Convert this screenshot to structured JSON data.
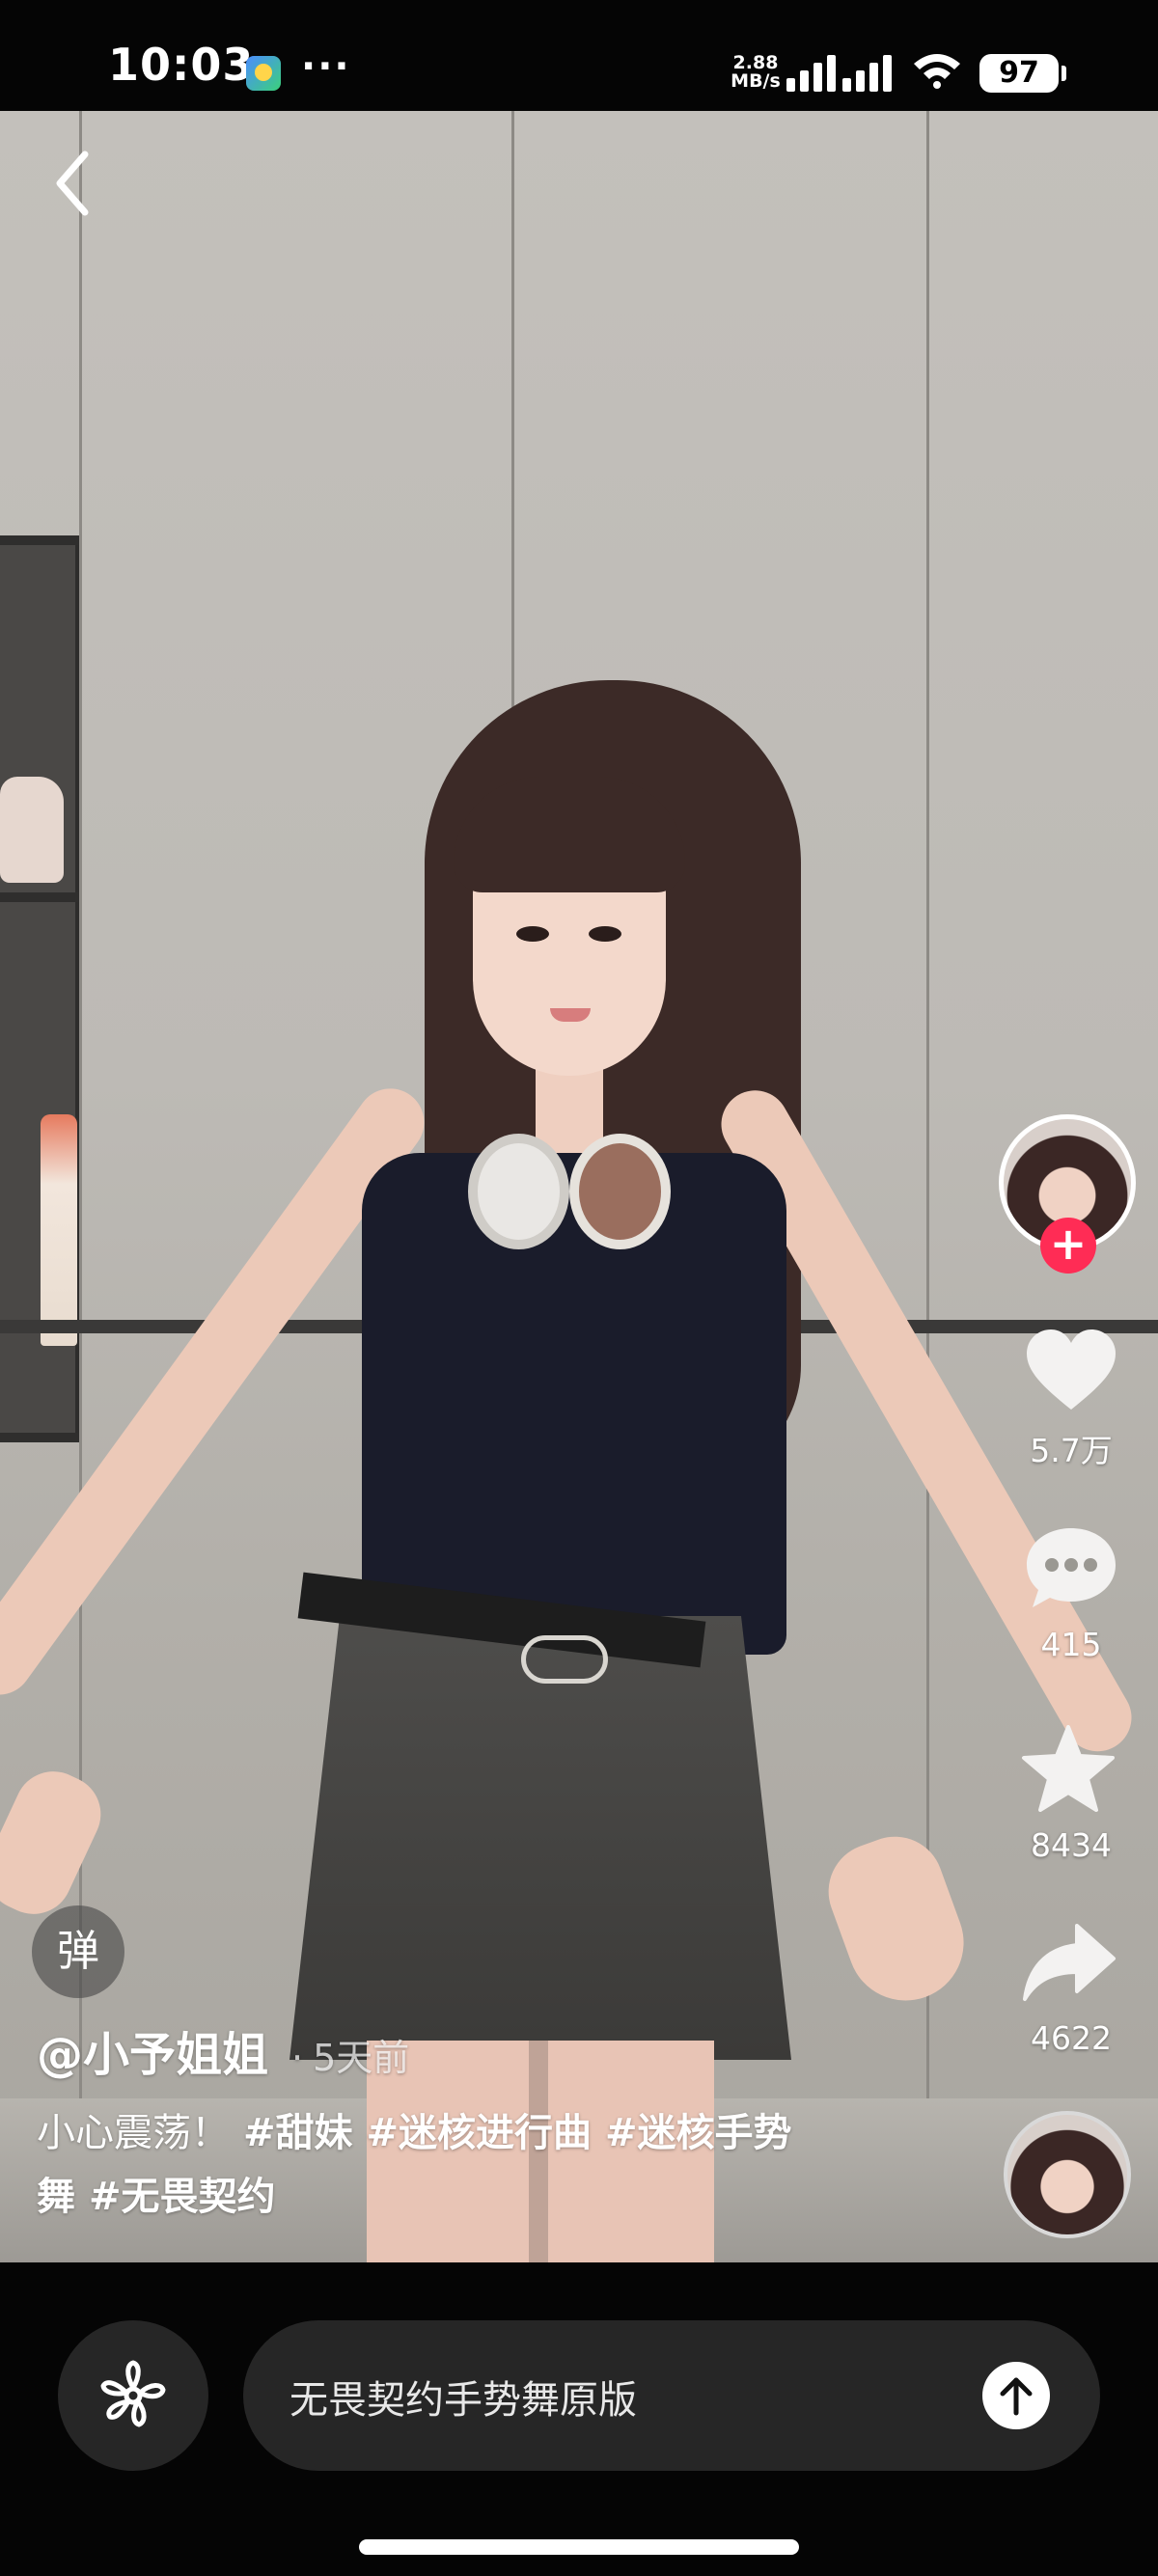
{
  "status_bar": {
    "time": "10:03",
    "net_speed_value": "2.88",
    "net_speed_unit": "MB/s",
    "battery": "97",
    "more_indicator": "···"
  },
  "video": {
    "description_icon": "back-chevron-icon"
  },
  "author": {
    "name": "@小予姐姐",
    "separator": "·",
    "time_ago": "5天前"
  },
  "caption": {
    "text": "小心震荡！",
    "hashtags": [
      "#甜妹",
      "#迷核进行曲",
      "#迷核手势",
      "舞",
      "#无畏契约"
    ]
  },
  "actions": {
    "likes": "5.7万",
    "comments": "415",
    "favorites": "8434",
    "shares": "4622",
    "follow_symbol": "+"
  },
  "danmu": {
    "label": "弹"
  },
  "bottom": {
    "search_text": "无畏契约手势舞原版"
  },
  "colors": {
    "follow_red": "#ff2c55",
    "bar_background": "#262626"
  }
}
